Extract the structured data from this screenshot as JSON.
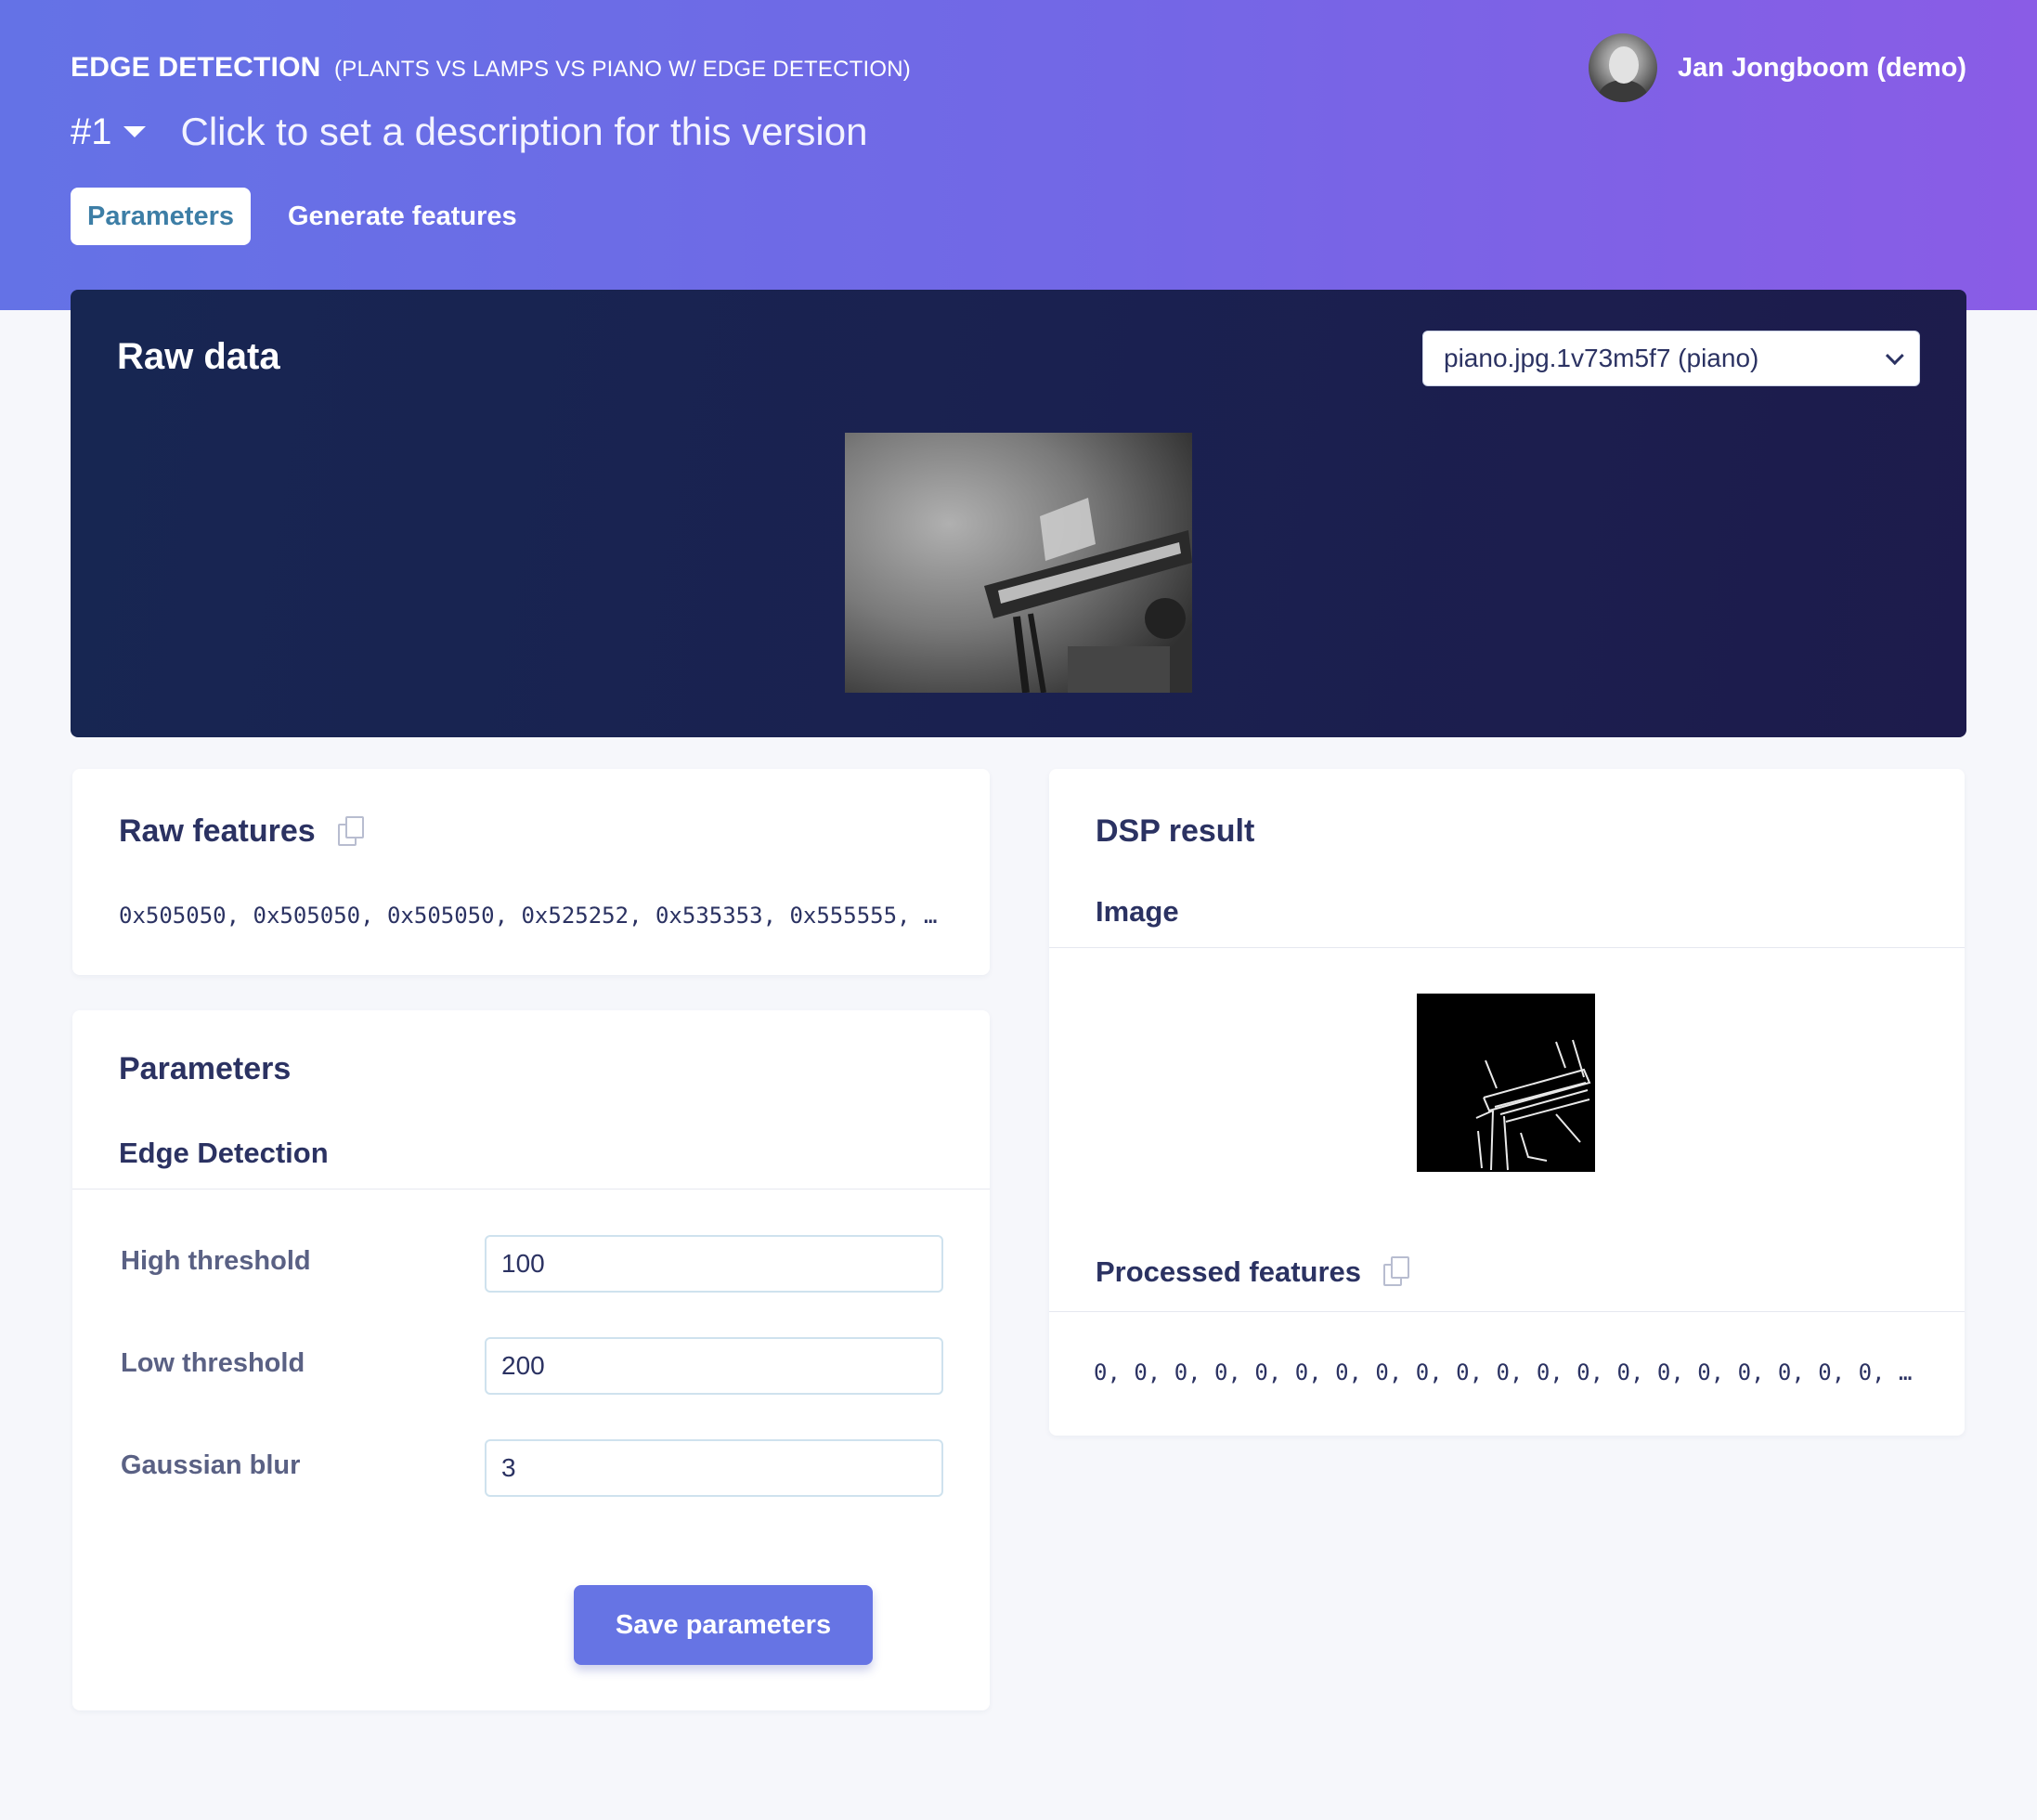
{
  "header": {
    "block_title": "EDGE DETECTION",
    "block_subtitle": "(PLANTS VS LAMPS VS PIANO W/ EDGE DETECTION)",
    "version": "#1",
    "version_description": "Click to set a description for this version",
    "tabs": [
      {
        "label": "Parameters",
        "active": true
      },
      {
        "label": "Generate features",
        "active": false
      }
    ],
    "user_name": "Jan Jongboom (demo)"
  },
  "raw_data": {
    "title": "Raw data",
    "selected_sample": "piano.jpg.1v73m5f7 (piano)"
  },
  "raw_features": {
    "title": "Raw features",
    "values": "0x505050, 0x505050, 0x505050, 0x525252, 0x535353, 0x555555, …"
  },
  "parameters": {
    "title": "Parameters",
    "section": "Edge Detection",
    "fields": [
      {
        "label": "High threshold",
        "value": "100"
      },
      {
        "label": "Low threshold",
        "value": "200"
      },
      {
        "label": "Gaussian blur",
        "value": "3"
      }
    ],
    "save_label": "Save parameters"
  },
  "dsp_result": {
    "title": "DSP result",
    "image_label": "Image",
    "processed_title": "Processed features",
    "processed_values": "0, 0, 0, 0, 0, 0, 0, 0, 0, 0, 0, 0, 0, 0, 0, 0, 0, 0, 0, 0, …"
  },
  "colors": {
    "header_gradient_start": "#6472e6",
    "header_gradient_end": "#8a5ce6",
    "raw_panel": "#1a2150",
    "primary_button": "#6674e4",
    "active_tab_text": "#3d7ea6"
  },
  "icons": [
    "caret-down-icon",
    "chevron-down-icon",
    "copy-icon"
  ]
}
